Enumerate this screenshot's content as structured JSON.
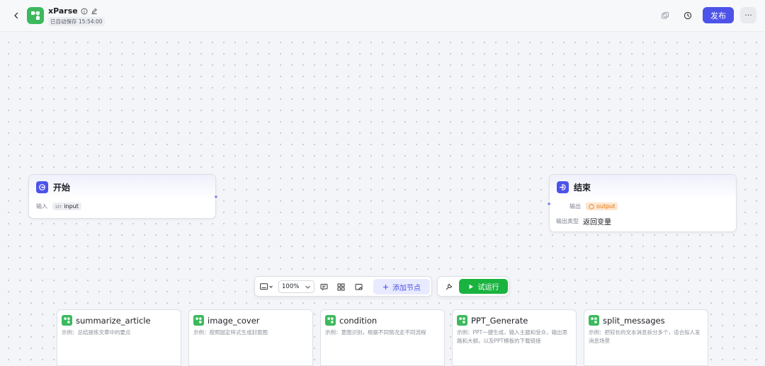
{
  "header": {
    "app_name": "xParse",
    "save_status": "已自动保存 15:54:00",
    "publish_label": "发布",
    "more_label": "···",
    "icons": [
      "chevron-left-icon",
      "info-icon",
      "edit-icon",
      "copy-icon",
      "history-icon"
    ]
  },
  "start_node": {
    "title": "开始",
    "input_label": "输入",
    "input_type": "str",
    "input_name": "input"
  },
  "end_node": {
    "title": "结束",
    "output_label": "输出",
    "output_name": "output",
    "output_type_label": "输出类型",
    "output_type_value": "返回变量"
  },
  "toolbar": {
    "zoom": "100%",
    "add_node_label": "添加节点",
    "run_label": "试运行"
  },
  "cards": [
    {
      "title": "summarize_article",
      "desc": "示例：总结提炼文章中的要点"
    },
    {
      "title": "image_cover",
      "desc": "示例：按照固定样式生成封面图"
    },
    {
      "title": "condition",
      "desc": "示例：意图识别，根据不同情况走不同流程"
    },
    {
      "title": "PPT_Generate",
      "desc": "示例：PPT一键生成，输入主题和受众，输出思路和大纲，以及PPT模板的下载链接"
    },
    {
      "title": "split_messages",
      "desc": "示例：把较长的文本消息拆分多个，适合拟人发消息场景"
    }
  ],
  "colors": {
    "accent": "#4d53e8",
    "run_green": "#1bb340",
    "plugin_green": "#3cb95d",
    "output_tag": "#e0761b"
  }
}
